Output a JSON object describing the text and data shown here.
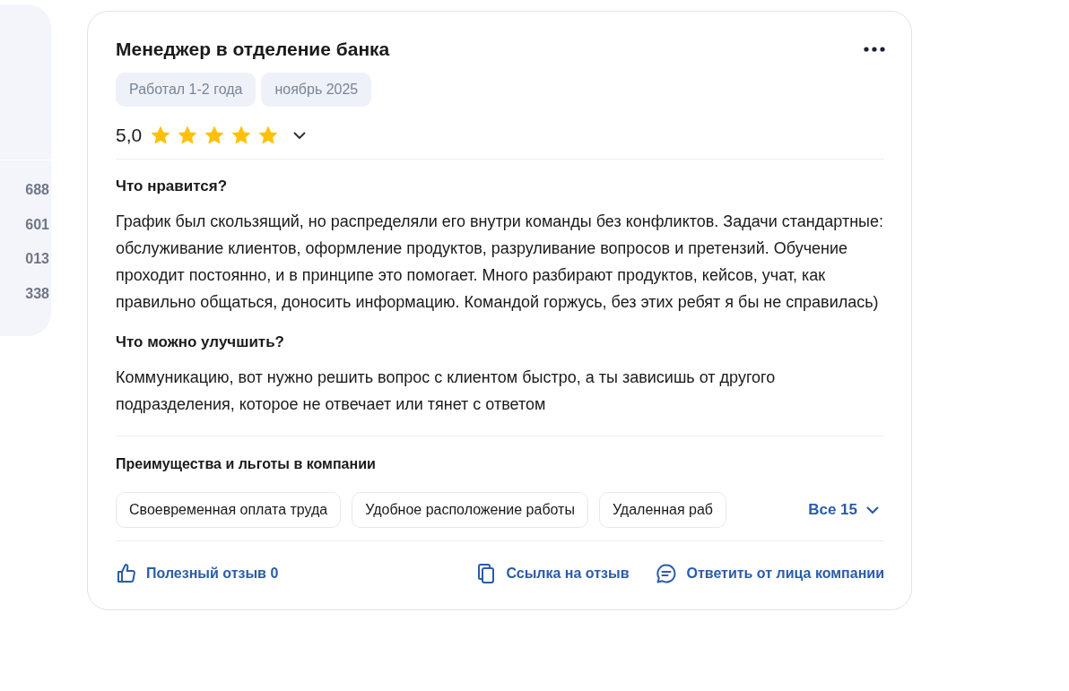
{
  "sidebar": {
    "values": [
      "688",
      "601",
      "013",
      "338"
    ]
  },
  "review": {
    "title": "Менеджер в отделение банка",
    "tags": [
      "Работал 1-2 года",
      "ноябрь 2025"
    ],
    "rating": "5,0",
    "stars": 5,
    "sections": [
      {
        "heading": "Что нравится?",
        "text": "График был скользящий, но распределяли его внутри команды без конфликтов. Задачи стандартные: обслуживание клиентов, оформление продуктов, разруливание вопросов и претензий. Обучение проходит постоянно, и в принципе это помогает. Много разбирают продуктов, кейсов, учат, как правильно общаться, доносить информацию. Командой горжусь, без этих ребят я бы не справилась)"
      },
      {
        "heading": "Что можно улучшить?",
        "text": "Коммуникацию, вот нужно решить вопрос с клиентом быстро, а ты зависишь от другого подразделения, которое не отвечает или тянет с ответом"
      }
    ],
    "benefits": {
      "heading": "Преимущества и льготы в компании",
      "items": [
        "Своевременная оплата труда",
        "Удобное расположение работы",
        "Удаленная раб"
      ],
      "more": "Все 15"
    },
    "actions": [
      {
        "kind": "like",
        "label": "Полезный отзыв 0"
      },
      {
        "kind": "link",
        "label": "Ссылка на отзыв"
      },
      {
        "kind": "reply",
        "label": "Ответить от лица компании"
      }
    ]
  }
}
